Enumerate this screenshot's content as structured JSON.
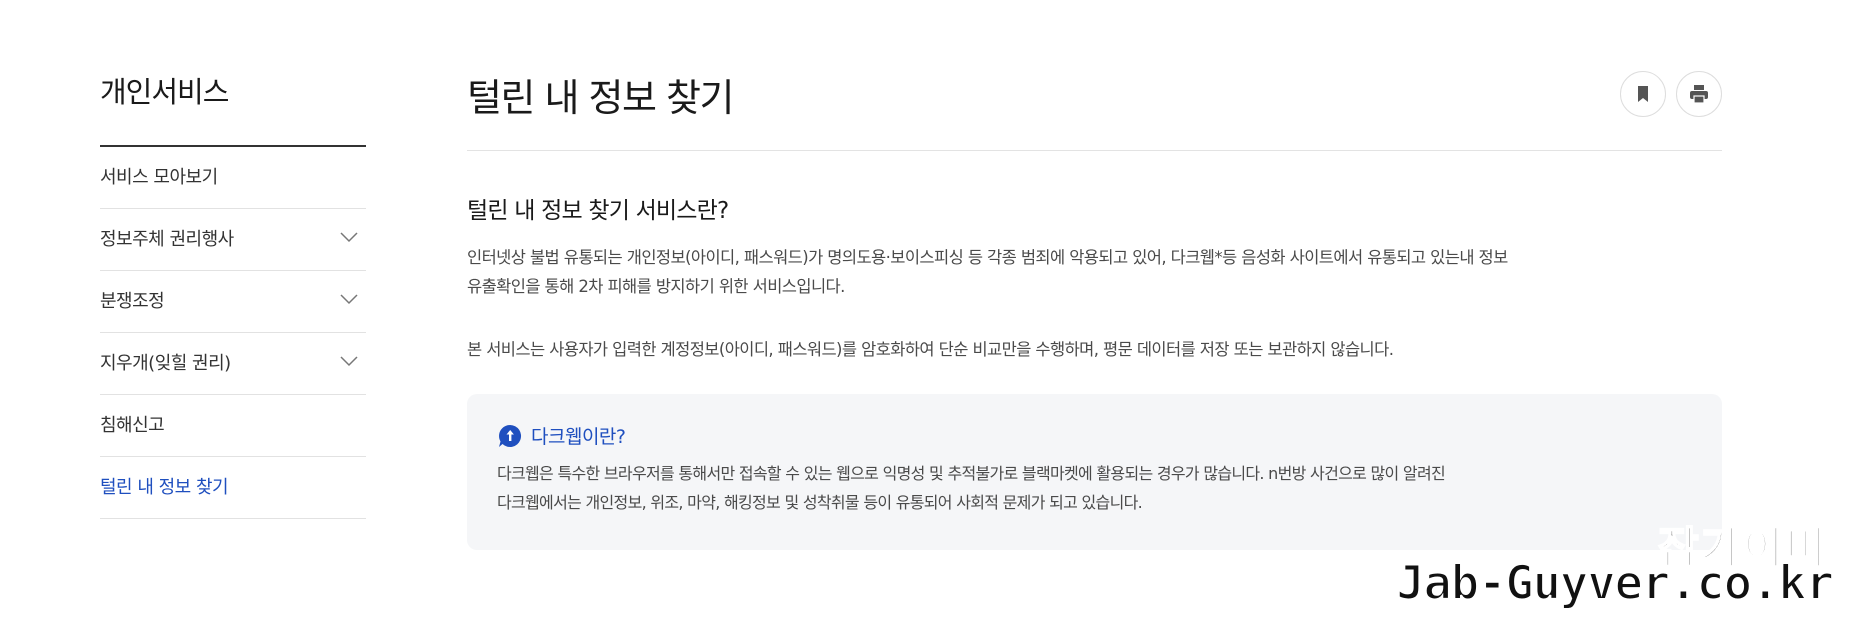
{
  "sidebar": {
    "title": "개인서비스",
    "items": [
      {
        "label": "서비스 모아보기",
        "expandable": false,
        "active": false
      },
      {
        "label": "정보주체 권리행사",
        "expandable": true,
        "active": false
      },
      {
        "label": "분쟁조정",
        "expandable": true,
        "active": false
      },
      {
        "label": "지우개(잊힐 권리)",
        "expandable": true,
        "active": false
      },
      {
        "label": "침해신고",
        "expandable": false,
        "active": false
      },
      {
        "label": "털린 내 정보 찾기",
        "expandable": false,
        "active": true
      }
    ]
  },
  "main": {
    "title": "털린 내 정보 찾기",
    "bookmark_icon": "bookmark-icon",
    "print_icon": "print-icon",
    "section_title": "털린 내 정보 찾기 서비스란?",
    "para1_line1": "인터넷상 불법 유통되는 개인정보(아이디, 패스워드)가 명의도용·보이스피싱 등 각종 범죄에 악용되고 있어, 다크웹*등 음성화 사이트에서 유통되고 있는내 정보",
    "para1_line2": "유출확인을 통해 2차 피해를 방지하기 위한 서비스입니다.",
    "para2": "본 서비스는 사용자가 입력한 계정정보(아이디, 패스워드)를 암호화하여 단순 비교만을 수행하며, 평문 데이터를 저장 또는 보관하지 않습니다.",
    "info": {
      "title": "다크웹이란?",
      "line1": "다크웹은 특수한 브라우저를 통해서만 접속할 수 있는 웹으로 익명성 및 추적불가로 블랙마켓에 활용되는 경우가 많습니다. n번방 사건으로 많이 알려진",
      "line2": "다크웹에서는 개인정보, 위조, 마약, 해킹정보 및 성착취물 등이 유통되어 사회적 문제가 되고 있습니다."
    }
  },
  "watermark": {
    "line1": "잡가이버",
    "line2": "Jab-Guyver.co.kr"
  },
  "colors": {
    "accent": "#1f4fbf",
    "info_bg": "#f5f6f8"
  }
}
